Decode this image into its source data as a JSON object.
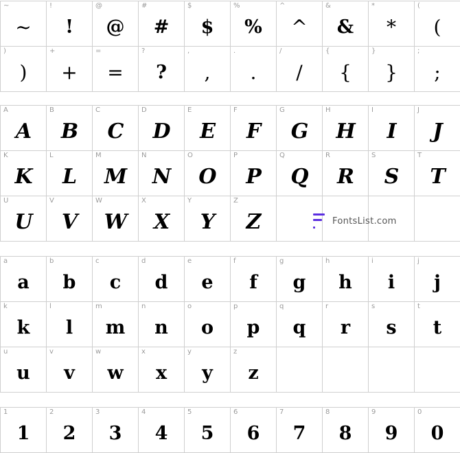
{
  "symbols": [
    {
      "label": "~",
      "glyph": "~"
    },
    {
      "label": "!",
      "glyph": "!"
    },
    {
      "label": "@",
      "glyph": "@"
    },
    {
      "label": "#",
      "glyph": "#"
    },
    {
      "label": "$",
      "glyph": "$"
    },
    {
      "label": "%",
      "glyph": "%"
    },
    {
      "label": "^",
      "glyph": "^"
    },
    {
      "label": "&",
      "glyph": "&"
    },
    {
      "label": "*",
      "glyph": "*"
    },
    {
      "label": "(",
      "glyph": "("
    },
    {
      "label": ")",
      "glyph": ")"
    },
    {
      "label": "+",
      "glyph": "+"
    },
    {
      "label": "=",
      "glyph": "="
    },
    {
      "label": "?",
      "glyph": "?"
    },
    {
      "label": ",",
      "glyph": ","
    },
    {
      "label": ".",
      "glyph": "."
    },
    {
      "label": "/",
      "glyph": "/"
    },
    {
      "label": "{",
      "glyph": "{"
    },
    {
      "label": "}",
      "glyph": "}"
    },
    {
      "label": ";",
      "glyph": ";"
    }
  ],
  "uppercase": [
    {
      "label": "A",
      "glyph": "A"
    },
    {
      "label": "B",
      "glyph": "B"
    },
    {
      "label": "C",
      "glyph": "C"
    },
    {
      "label": "D",
      "glyph": "D"
    },
    {
      "label": "E",
      "glyph": "E"
    },
    {
      "label": "F",
      "glyph": "F"
    },
    {
      "label": "G",
      "glyph": "G"
    },
    {
      "label": "H",
      "glyph": "H"
    },
    {
      "label": "I",
      "glyph": "I"
    },
    {
      "label": "J",
      "glyph": "J"
    },
    {
      "label": "K",
      "glyph": "K"
    },
    {
      "label": "L",
      "glyph": "L"
    },
    {
      "label": "M",
      "glyph": "M"
    },
    {
      "label": "N",
      "glyph": "N"
    },
    {
      "label": "O",
      "glyph": "O"
    },
    {
      "label": "P",
      "glyph": "P"
    },
    {
      "label": "Q",
      "glyph": "Q"
    },
    {
      "label": "R",
      "glyph": "R"
    },
    {
      "label": "S",
      "glyph": "S"
    },
    {
      "label": "T",
      "glyph": "T"
    },
    {
      "label": "U",
      "glyph": "U"
    },
    {
      "label": "V",
      "glyph": "V"
    },
    {
      "label": "W",
      "glyph": "W"
    },
    {
      "label": "X",
      "glyph": "X"
    },
    {
      "label": "Y",
      "glyph": "Y"
    },
    {
      "label": "Z",
      "glyph": "Z"
    }
  ],
  "lowercase": [
    {
      "label": "a",
      "glyph": "a"
    },
    {
      "label": "b",
      "glyph": "b"
    },
    {
      "label": "c",
      "glyph": "c"
    },
    {
      "label": "d",
      "glyph": "d"
    },
    {
      "label": "e",
      "glyph": "e"
    },
    {
      "label": "f",
      "glyph": "f"
    },
    {
      "label": "g",
      "glyph": "g"
    },
    {
      "label": "h",
      "glyph": "h"
    },
    {
      "label": "i",
      "glyph": "i"
    },
    {
      "label": "j",
      "glyph": "j"
    },
    {
      "label": "k",
      "glyph": "k"
    },
    {
      "label": "l",
      "glyph": "l"
    },
    {
      "label": "m",
      "glyph": "m"
    },
    {
      "label": "n",
      "glyph": "n"
    },
    {
      "label": "o",
      "glyph": "o"
    },
    {
      "label": "p",
      "glyph": "p"
    },
    {
      "label": "q",
      "glyph": "q"
    },
    {
      "label": "r",
      "glyph": "r"
    },
    {
      "label": "s",
      "glyph": "s"
    },
    {
      "label": "t",
      "glyph": "t"
    },
    {
      "label": "u",
      "glyph": "u"
    },
    {
      "label": "v",
      "glyph": "v"
    },
    {
      "label": "w",
      "glyph": "w"
    },
    {
      "label": "x",
      "glyph": "x"
    },
    {
      "label": "y",
      "glyph": "y"
    },
    {
      "label": "z",
      "glyph": "z"
    }
  ],
  "digits": [
    {
      "label": "1",
      "glyph": "1"
    },
    {
      "label": "2",
      "glyph": "2"
    },
    {
      "label": "3",
      "glyph": "3"
    },
    {
      "label": "4",
      "glyph": "4"
    },
    {
      "label": "5",
      "glyph": "5"
    },
    {
      "label": "6",
      "glyph": "6"
    },
    {
      "label": "7",
      "glyph": "7"
    },
    {
      "label": "8",
      "glyph": "8"
    },
    {
      "label": "9",
      "glyph": "9"
    },
    {
      "label": "0",
      "glyph": "0"
    }
  ],
  "watermark": {
    "text": "FontsList.com",
    "logo_icon": "fontslist-logo-icon",
    "logo_color": "#5b2ee0"
  },
  "colors": {
    "grid_line": "#cfcfcf",
    "label": "#9a9a9a",
    "glyph": "#000000"
  }
}
